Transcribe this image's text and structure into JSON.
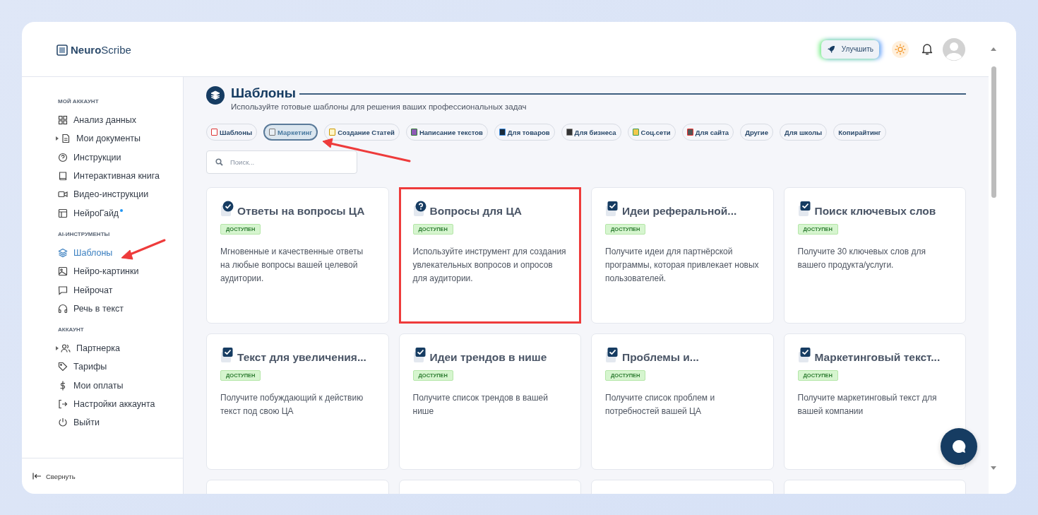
{
  "brand": {
    "bold": "Neuro",
    "rest": "Scribe"
  },
  "header": {
    "upgrade": "Улучшить"
  },
  "sidebar": {
    "sections": [
      {
        "title": "МОЙ АККАУНТ",
        "items": [
          {
            "label": "Анализ данных",
            "kind": "grid",
            "selected": false,
            "expandable": false,
            "dot": false
          },
          {
            "label": "Мои документы",
            "kind": "doc",
            "selected": false,
            "expandable": true,
            "dot": false
          },
          {
            "label": "Инструкции",
            "kind": "help",
            "selected": false,
            "expandable": false,
            "dot": false
          },
          {
            "label": "Интерактивная книга",
            "kind": "book",
            "selected": false,
            "expandable": false,
            "dot": false
          },
          {
            "label": "Видео-инструкции",
            "kind": "video",
            "selected": false,
            "expandable": false,
            "dot": false
          },
          {
            "label": "НейроГайд",
            "kind": "layout",
            "selected": false,
            "expandable": false,
            "dot": true
          }
        ]
      },
      {
        "title": "AI-ИНСТРУМЕНТЫ",
        "items": [
          {
            "label": "Шаблоны",
            "kind": "layers",
            "selected": true,
            "expandable": false,
            "dot": false
          },
          {
            "label": "Нейро-картинки",
            "kind": "image",
            "selected": false,
            "expandable": false,
            "dot": false
          },
          {
            "label": "Нейрочат",
            "kind": "chat",
            "selected": false,
            "expandable": false,
            "dot": false
          },
          {
            "label": "Речь в текст",
            "kind": "headphones",
            "selected": false,
            "expandable": false,
            "dot": false
          }
        ]
      },
      {
        "title": "АККАУНТ",
        "items": [
          {
            "label": "Партнерка",
            "kind": "users",
            "selected": false,
            "expandable": true,
            "dot": false
          },
          {
            "label": "Тарифы",
            "kind": "tag",
            "selected": false,
            "expandable": false,
            "dot": false
          },
          {
            "label": "Мои оплаты",
            "kind": "dollar",
            "selected": false,
            "expandable": false,
            "dot": false
          },
          {
            "label": "Настройки аккаунта",
            "kind": "logout",
            "selected": false,
            "expandable": false,
            "dot": false
          },
          {
            "label": "Выйти",
            "kind": "power",
            "selected": false,
            "expandable": false,
            "dot": false
          }
        ]
      }
    ],
    "collapse": "Свернуть"
  },
  "page": {
    "title": "Шаблоны",
    "subtitle": "Используйте готовые шаблоны для решения ваших профессиональных задач"
  },
  "filters": [
    {
      "label": "Шаблоны",
      "kind": "chart",
      "selected": false
    },
    {
      "label": "Маркетинг",
      "kind": "calendar",
      "selected": true
    },
    {
      "label": "Создание Статей",
      "kind": "memo",
      "selected": false
    },
    {
      "label": "Написание текстов",
      "kind": "books",
      "selected": false
    },
    {
      "label": "Для товаров",
      "kind": "phone",
      "selected": false
    },
    {
      "label": "Для бизнеса",
      "kind": "laptop",
      "selected": false
    },
    {
      "label": "Соц.сети",
      "kind": "ledger",
      "selected": false
    },
    {
      "label": "Для сайта",
      "kind": "cat",
      "selected": false
    },
    {
      "label": "Другие",
      "kind": "plain",
      "selected": false
    },
    {
      "label": "Для школы",
      "kind": "plain",
      "selected": false
    },
    {
      "label": "Копирайтинг",
      "kind": "plain",
      "selected": false
    }
  ],
  "search": {
    "placeholder": "Поиск..."
  },
  "cards": [
    {
      "title": "Ответы на вопросы ЦА",
      "kind": "check-circle",
      "badge": "ДОСТУПЕН",
      "description": "Мгновенные и качественные ответы на любые вопросы вашей целевой аудитории.",
      "highlighted": false
    },
    {
      "title": "Вопросы для ЦА",
      "kind": "question",
      "badge": "ДОСТУПЕН",
      "description": "Используйте инструмент для создания увлекательных вопросов и опросов для аудитории.",
      "highlighted": true
    },
    {
      "title": "Идеи реферальной...",
      "kind": "checkbox",
      "badge": "ДОСТУПЕН",
      "description": "Получите идеи для партнёрской программы, которая привлекает новых пользователей.",
      "highlighted": false
    },
    {
      "title": "Поиск ключевых слов",
      "kind": "checkbox",
      "badge": "ДОСТУПЕН",
      "description": "Получите 30 ключевых слов для вашего продукта/услуги.",
      "highlighted": false
    },
    {
      "title": "Текст для увеличения...",
      "kind": "checkbox",
      "badge": "ДОСТУПЕН",
      "description": "Получите побуждающий к действию текст под свою ЦА",
      "highlighted": false
    },
    {
      "title": "Идеи трендов в нише",
      "kind": "checkbox",
      "badge": "ДОСТУПЕН",
      "description": "Получите список трендов в вашей нише",
      "highlighted": false
    },
    {
      "title": "Проблемы и...",
      "kind": "checkbox",
      "badge": "ДОСТУПЕН",
      "description": "Получите список проблем и потребностей вашей ЦА",
      "highlighted": false
    },
    {
      "title": "Маркетинговый текст...",
      "kind": "checkbox",
      "badge": "ДОСТУПЕН",
      "description": "Получите маркетинговый текст для вашей компании",
      "highlighted": false
    }
  ]
}
